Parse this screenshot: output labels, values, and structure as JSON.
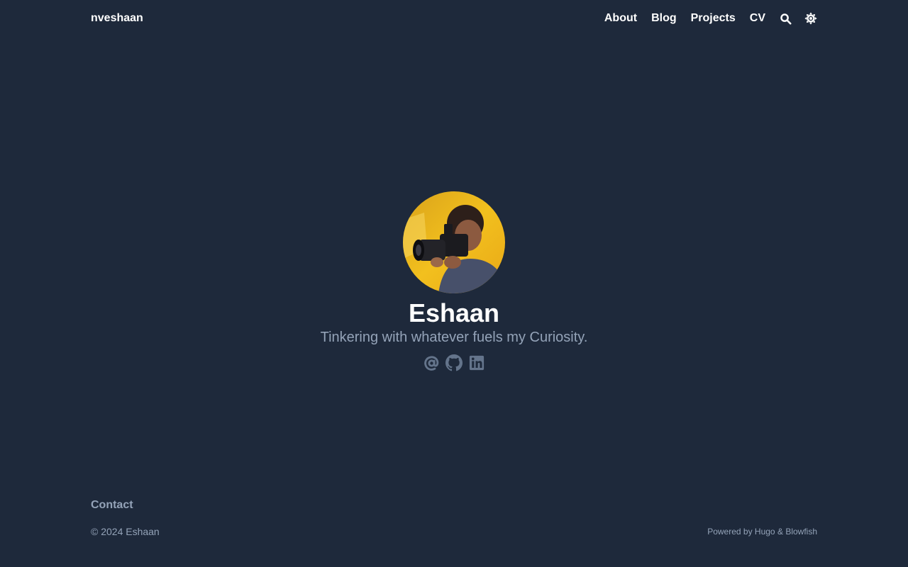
{
  "header": {
    "site_title": "nveshaan",
    "nav": [
      {
        "label": "About"
      },
      {
        "label": "Blog"
      },
      {
        "label": "Projects"
      },
      {
        "label": "CV"
      }
    ],
    "icons": {
      "search": "search-icon",
      "appearance": "sun-icon"
    }
  },
  "hero": {
    "avatar": "avatar-photo",
    "name": "Eshaan",
    "tagline": "Tinkering with whatever fuels my Curiosity.",
    "social": [
      {
        "icon": "at-sign-icon"
      },
      {
        "icon": "github-icon"
      },
      {
        "icon": "linkedin-icon"
      }
    ]
  },
  "footer": {
    "contact_label": "Contact",
    "copyright": "© 2024 Eshaan",
    "powered_prefix": "Powered by",
    "hugo_label": "Hugo",
    "amp": "&",
    "blowfish_label": "Blowfish"
  },
  "colors": {
    "background": "#1e293b",
    "text_primary": "#ffffff",
    "text_muted": "#94a3b8",
    "icon_muted": "#64748b"
  }
}
